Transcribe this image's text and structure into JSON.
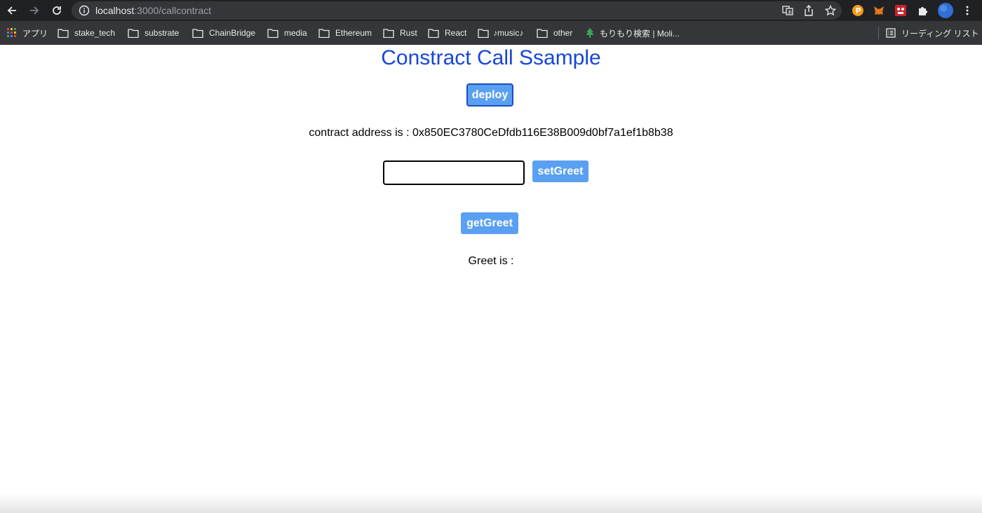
{
  "browser": {
    "url_host": "localhost",
    "url_path": ":3000/callcontract",
    "bookmarks": [
      {
        "label": "アプリ",
        "icon": "apps-grid-icon"
      },
      {
        "label": "stake_tech",
        "icon": "folder-icon"
      },
      {
        "label": "substrate",
        "icon": "folder-icon"
      },
      {
        "label": "ChainBridge",
        "icon": "folder-icon"
      },
      {
        "label": "media",
        "icon": "folder-icon"
      },
      {
        "label": "Ethereum",
        "icon": "folder-icon"
      },
      {
        "label": "Rust",
        "icon": "folder-icon"
      },
      {
        "label": "React",
        "icon": "folder-icon"
      },
      {
        "label": "♪music♪",
        "icon": "folder-icon"
      },
      {
        "label": "other",
        "icon": "folder-icon"
      },
      {
        "label": "もりもり検索 | Moli...",
        "icon": "tree-icon"
      }
    ],
    "reading_list": "リーディング リスト"
  },
  "page": {
    "title": "Constract Call Ssample",
    "deploy_label": "deploy",
    "contract_address_text": "contract address is : 0x850EC3780CeDfdb116E38B009d0bf7a1ef1b8b38",
    "greet_input_value": "",
    "set_greet_label": "setGreet",
    "get_greet_label": "getGreet",
    "greet_text": "Greet is :"
  },
  "colors": {
    "title": "#1746d8",
    "button": "#5aa0f2",
    "chrome_dark": "#202124",
    "chrome_bar": "#35363a"
  }
}
